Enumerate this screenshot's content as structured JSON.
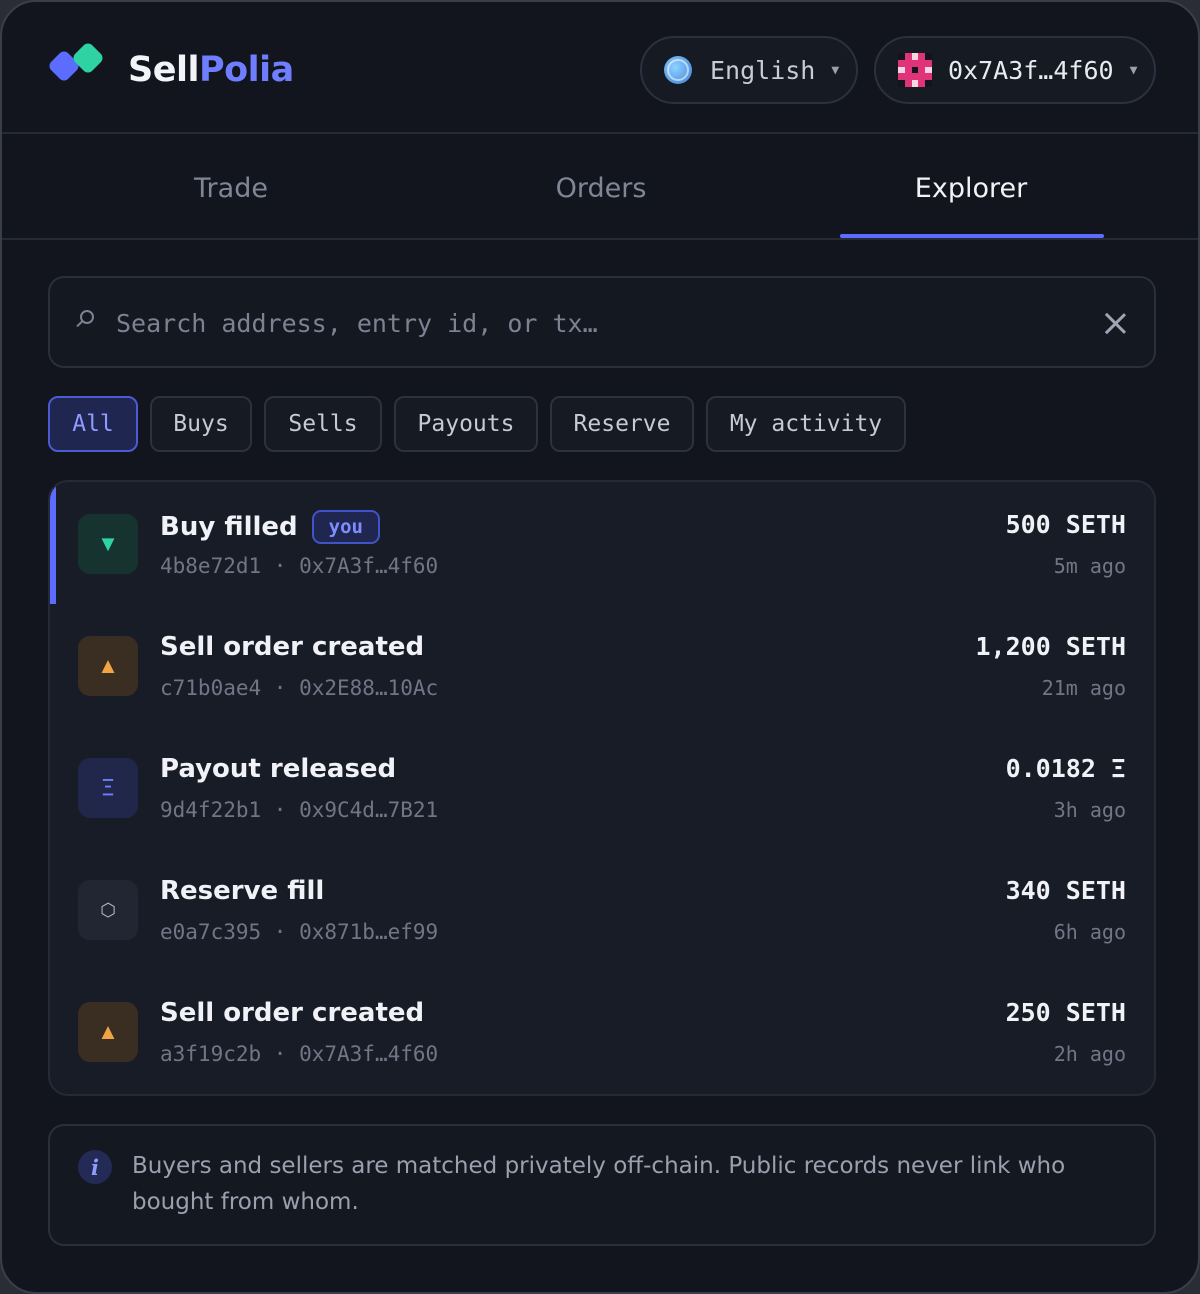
{
  "app": {
    "brand_part1": "Sell",
    "brand_part2": "Polia",
    "brand_colors": {
      "primary": "#5b6cff",
      "secondary": "#2fd3a3"
    }
  },
  "header": {
    "language": {
      "label": "English",
      "icon": "globe-icon"
    },
    "wallet": {
      "address": "0x7A3f…4f60",
      "icon": "identicon-avatar"
    }
  },
  "tabs": [
    {
      "label": "Trade",
      "active": false
    },
    {
      "label": "Orders",
      "active": false
    },
    {
      "label": "Explorer",
      "active": true
    }
  ],
  "search": {
    "placeholder": "Search address, entry id, or tx…",
    "value": ""
  },
  "filters": [
    {
      "label": "All",
      "active": true
    },
    {
      "label": "Buys",
      "active": false
    },
    {
      "label": "Sells",
      "active": false
    },
    {
      "label": "Payouts",
      "active": false
    },
    {
      "label": "Reserve",
      "active": false
    },
    {
      "label": "My activity",
      "active": false
    }
  ],
  "entries": [
    {
      "kind": "buy",
      "icon": "▼",
      "title": "Buy filled",
      "badge": "you",
      "id": "4b8e72d1",
      "address": "0x7A3f…4f60",
      "amount": "500 SETH",
      "time": "5m ago"
    },
    {
      "kind": "sell",
      "icon": "▲",
      "title": "Sell order created",
      "id": "c71b0ae4",
      "address": "0x2E88…10Ac",
      "amount": "1,200 SETH",
      "time": "21m ago"
    },
    {
      "kind": "payout",
      "icon": "Ξ",
      "title": "Payout released",
      "id": "9d4f22b1",
      "address": "0x9C4d…7B21",
      "amount": "0.0182 Ξ",
      "time": "3h ago"
    },
    {
      "kind": "reserve",
      "icon": "⬡",
      "title": "Reserve fill",
      "id": "e0a7c395",
      "address": "0x871b…ef99",
      "amount": "340 SETH",
      "time": "6h ago"
    },
    {
      "kind": "sell",
      "icon": "▲",
      "title": "Sell order created",
      "id": "a3f19c2b",
      "address": "0x7A3f…4f60",
      "amount": "250 SETH",
      "time": "2h ago"
    }
  ],
  "info": {
    "icon": "i",
    "text": "Buyers and sellers are matched privately off-chain. Public records never link who bought from whom."
  }
}
